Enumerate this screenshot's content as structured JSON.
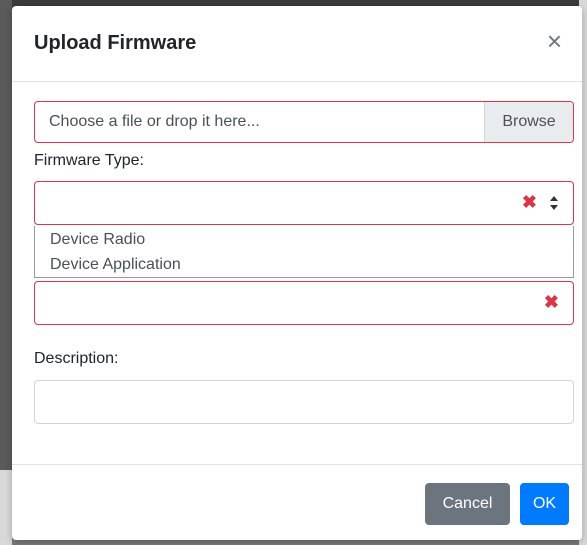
{
  "modal": {
    "title": "Upload Firmware",
    "close_glyph": "×"
  },
  "file_input": {
    "placeholder": "Choose a file or drop it here...",
    "browse_label": "Browse"
  },
  "firmware_type": {
    "label": "Firmware Type:",
    "value": "",
    "options": [
      "Device Radio",
      "Device Application"
    ]
  },
  "version_input": {
    "value": ""
  },
  "description": {
    "label": "Description:",
    "value": ""
  },
  "footer": {
    "cancel_label": "Cancel",
    "ok_label": "OK"
  },
  "icons": {
    "clear": "clear-icon",
    "updown": "sort-updown-icon",
    "close": "close-icon"
  },
  "colors": {
    "error": "#dc3545",
    "primary": "#007bff",
    "secondary": "#6c757d"
  }
}
